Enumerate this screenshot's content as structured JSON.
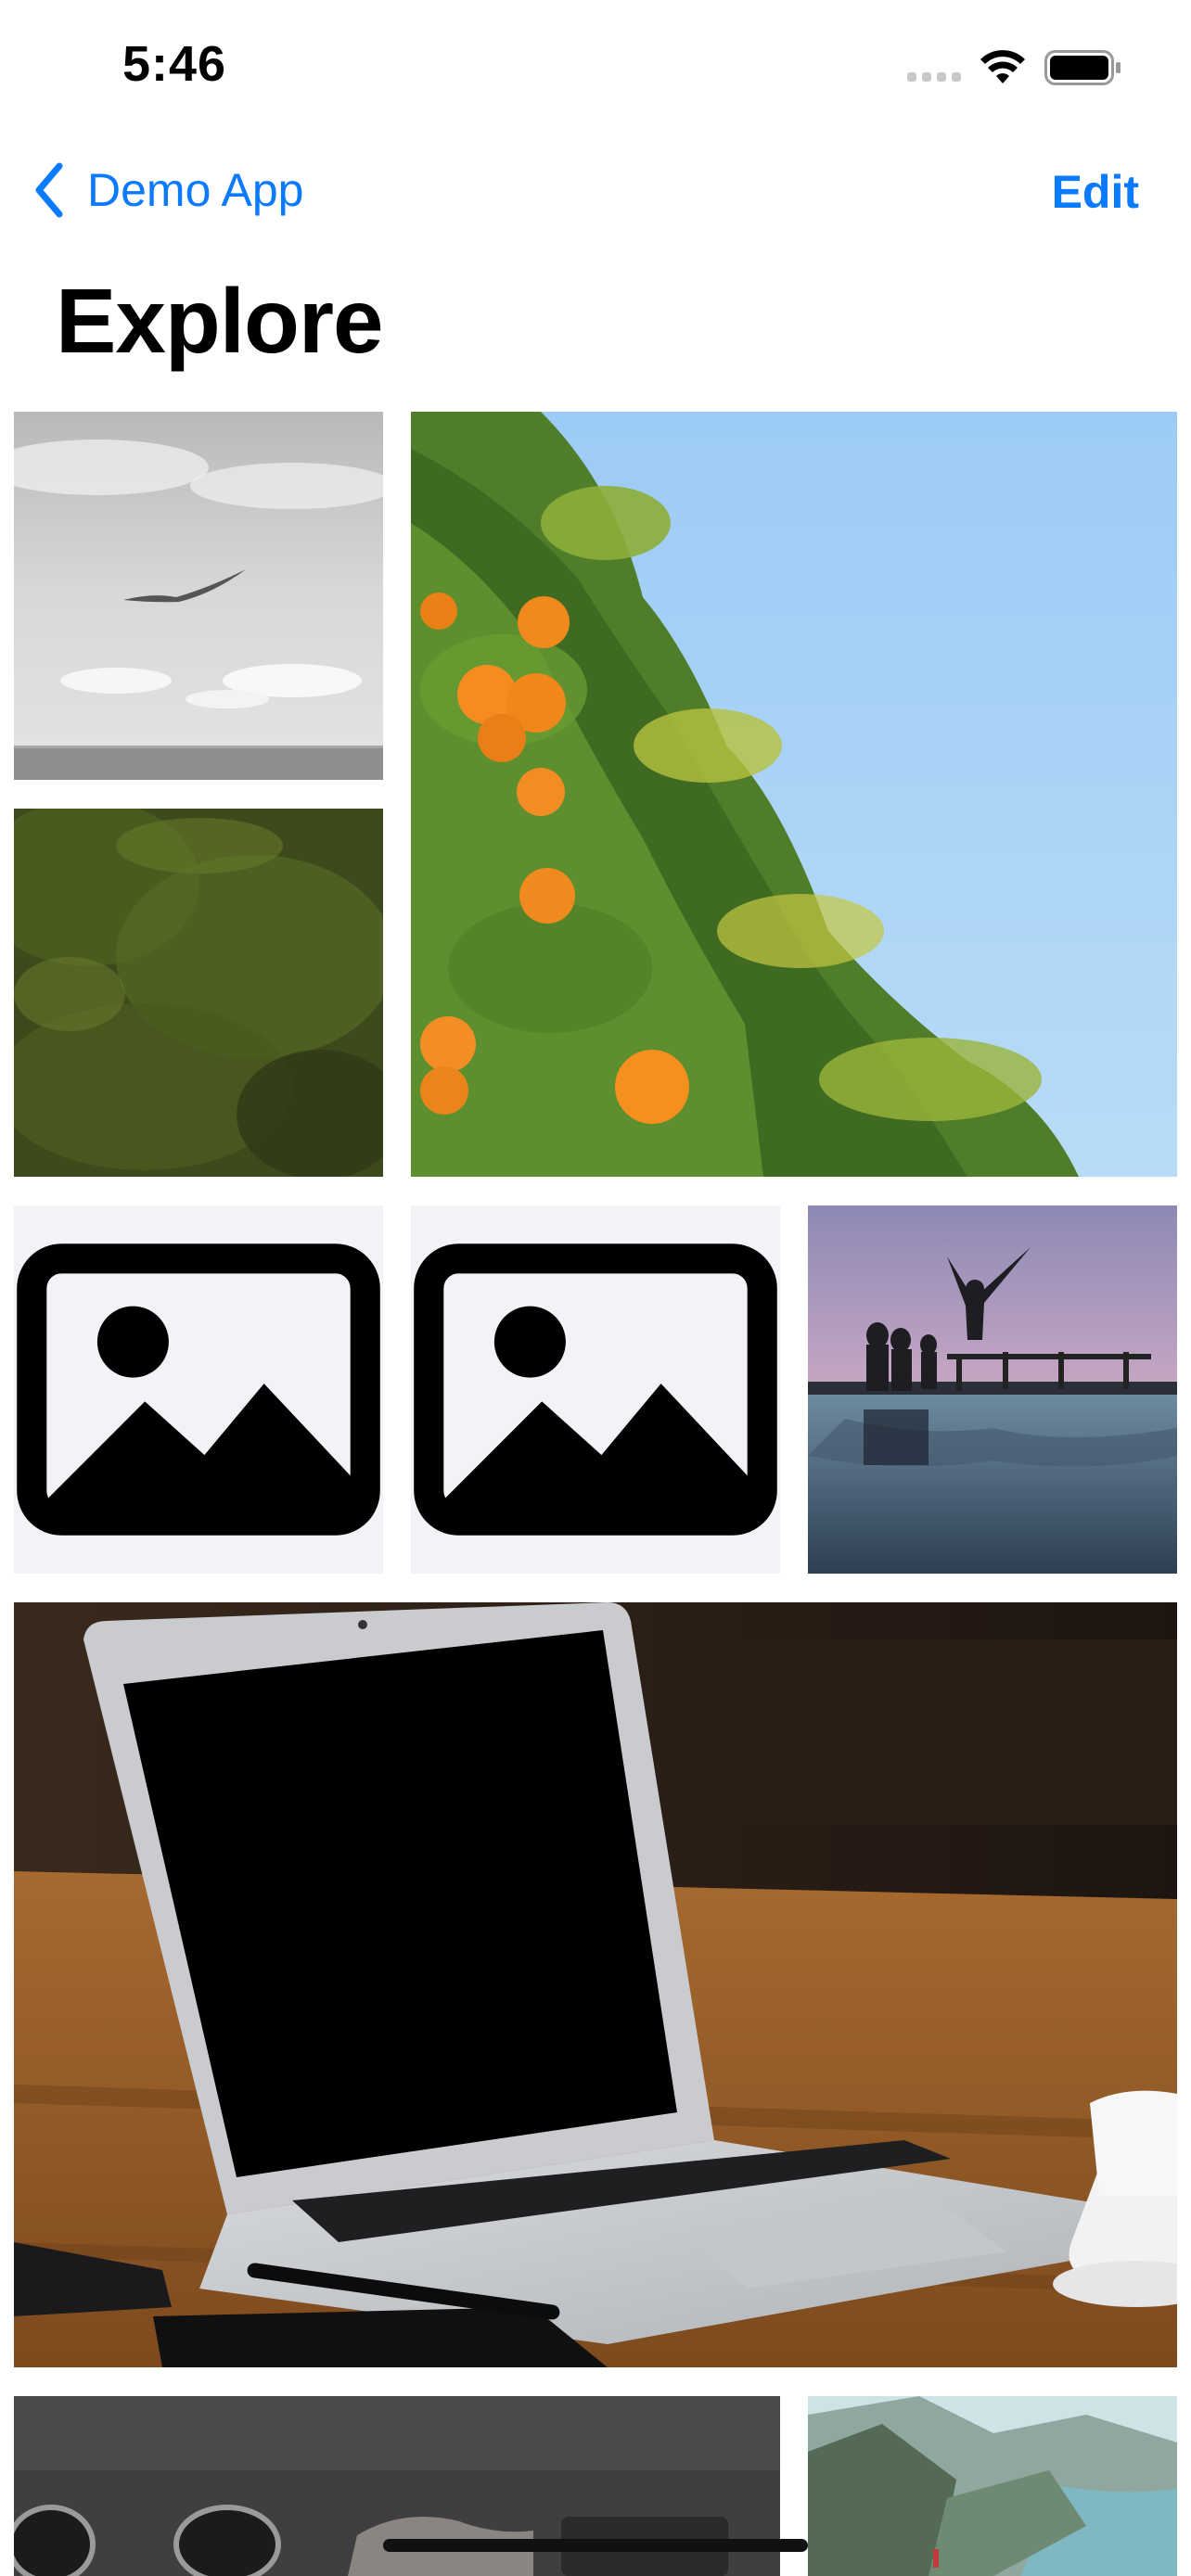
{
  "status_bar": {
    "time": "5:46",
    "icons": [
      "signal-dots-icon",
      "wifi-icon",
      "battery-icon"
    ]
  },
  "nav": {
    "back_label": "Demo App",
    "back_icon": "chevron-left-icon",
    "edit_label": "Edit",
    "accent_color": "#0A7AFF"
  },
  "page": {
    "title": "Explore"
  },
  "grid": {
    "items": [
      {
        "kind": "photo",
        "subject": "seagull over sea, grayscale"
      },
      {
        "kind": "photo",
        "subject": "orange tree against blue sky"
      },
      {
        "kind": "photo",
        "subject": "aerial view of green forest"
      },
      {
        "kind": "placeholder",
        "icon": "photo-placeholder-icon"
      },
      {
        "kind": "placeholder",
        "icon": "photo-placeholder-icon"
      },
      {
        "kind": "photo",
        "subject": "people jumping into water at sunset"
      },
      {
        "kind": "photo",
        "subject": "laptop on wooden table"
      },
      {
        "kind": "photo",
        "subject": "sunglasses and desk items"
      },
      {
        "kind": "photo",
        "subject": "mountain lake landscape"
      }
    ],
    "placeholder_color": "#F2F2F7"
  }
}
